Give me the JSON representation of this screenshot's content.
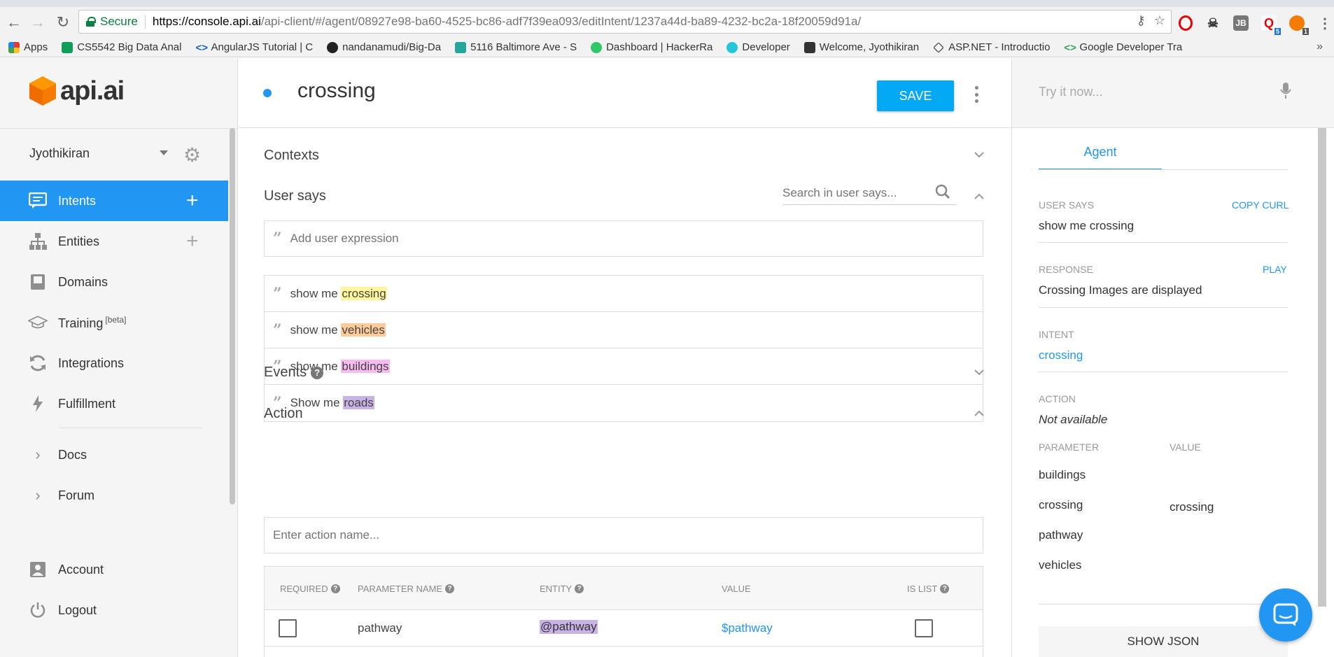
{
  "browser": {
    "secure_label": "Secure",
    "url_host": "https://console.api.ai",
    "url_path": "/api-client/#/agent/08927e98-ba60-4525-bc86-adf7f39ea093/editIntent/1237a44d-ba89-4232-bc2a-18f20059d91a/",
    "bookmarks": [
      {
        "label": "Apps",
        "color": "#e53935"
      },
      {
        "label": "CS5542 Big Data Anal",
        "color": "#0f9d58"
      },
      {
        "label": "AngularJS Tutorial | C",
        "color": "#1565c0"
      },
      {
        "label": "nandanamudi/Big-Da",
        "color": "#222222"
      },
      {
        "label": "5116 Baltimore Ave - S",
        "color": "#26a69a"
      },
      {
        "label": "Dashboard | HackerRa",
        "color": "#2ec866"
      },
      {
        "label": "Developer",
        "color": "#26c6da"
      },
      {
        "label": "Welcome, Jyothikiran",
        "color": "#333333"
      },
      {
        "label": "ASP.NET - Introductio",
        "color": "#555555"
      },
      {
        "label": "Google Developer Tra",
        "color": "#34a853"
      }
    ],
    "bookmarks_more": "»",
    "ext_badges": [
      "5",
      "1"
    ]
  },
  "sidebar": {
    "logo_text": "api.ai",
    "user": "Jyothikiran",
    "items": [
      {
        "label": "Intents",
        "icon": "chat-icon",
        "active": true,
        "plus": true
      },
      {
        "label": "Entities",
        "icon": "hierarchy-icon",
        "active": false,
        "plus": true
      },
      {
        "label": "Domains",
        "icon": "book-icon",
        "active": false,
        "plus": false
      },
      {
        "label": "Training",
        "beta": "[beta]",
        "icon": "graduation-cap-icon",
        "active": false,
        "plus": false
      },
      {
        "label": "Integrations",
        "icon": "refresh-icon",
        "active": false,
        "plus": false
      },
      {
        "label": "Fulfillment",
        "icon": "lightning-icon",
        "active": false,
        "plus": false
      },
      {
        "label": "Docs",
        "icon": "chevron-right-icon"
      },
      {
        "label": "Forum",
        "icon": "chevron-right-icon"
      },
      {
        "label": "Account",
        "icon": "account-icon"
      },
      {
        "label": "Logout",
        "icon": "power-icon"
      }
    ]
  },
  "main": {
    "intent_name": "crossing",
    "save_label": "SAVE",
    "contexts_title": "Contexts",
    "user_says_title": "User says",
    "search_placeholder": "Search in user says...",
    "add_expression_placeholder": "Add user expression",
    "expressions": [
      {
        "prefix": "show me ",
        "entity": "crossing",
        "color": "#fff59d"
      },
      {
        "prefix": "show me ",
        "entity": "vehicles",
        "color": "#ffcc99"
      },
      {
        "prefix": "show me ",
        "entity": "buildings",
        "color": "#f8bbf0"
      },
      {
        "prefix": "Show me ",
        "entity": "roads",
        "color": "#c9b3e6"
      }
    ],
    "events_title": "Events",
    "action_title": "Action",
    "action_placeholder": "Enter action name...",
    "param_headers": {
      "required": "REQUIRED",
      "name": "PARAMETER NAME",
      "entity": "ENTITY",
      "value": "VALUE",
      "is_list": "IS LIST"
    },
    "params": [
      {
        "name": "pathway",
        "entity": "@pathway",
        "value": "$pathway",
        "entity_color": "#c9b3e6"
      }
    ]
  },
  "right": {
    "try_placeholder": "Try it now...",
    "tab_agent": "Agent",
    "user_says_label": "USER SAYS",
    "copy_curl": "COPY CURL",
    "user_says_value": "show me crossing",
    "response_label": "RESPONSE",
    "play": "PLAY",
    "response_value": "Crossing Images are displayed",
    "intent_label": "INTENT",
    "intent_value": "crossing",
    "action_label": "ACTION",
    "action_value": "Not available",
    "parameter_label": "PARAMETER",
    "value_label": "VALUE",
    "parameters": [
      "buildings",
      "crossing",
      "pathway",
      "vehicles"
    ],
    "param_value_crossing": "crossing",
    "show_json": "SHOW JSON"
  }
}
